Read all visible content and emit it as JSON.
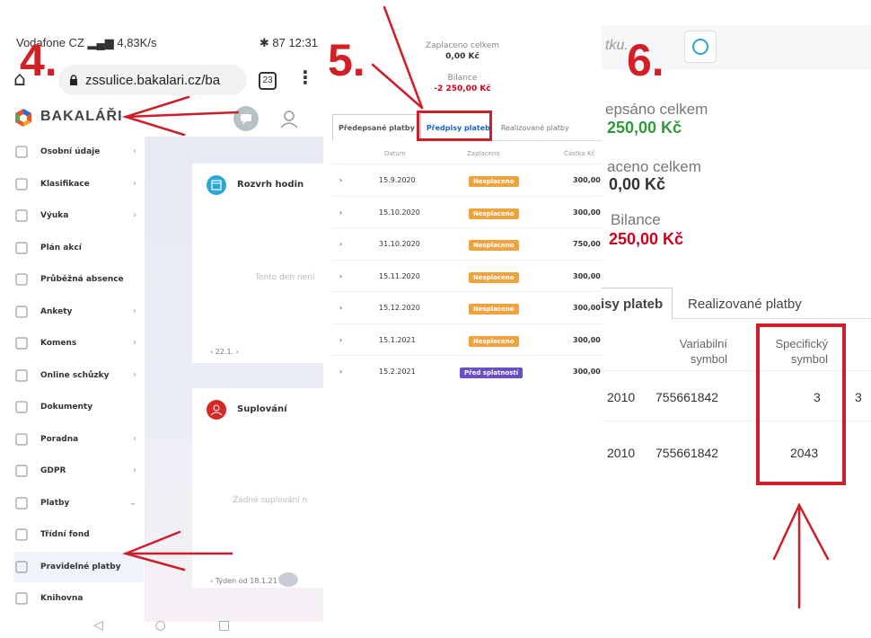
{
  "steps": {
    "s4": "4.",
    "s5": "5.",
    "s6": "6."
  },
  "phone": {
    "carrier": "Vodafone CZ",
    "speed": "4,83K/s",
    "battery": "87",
    "time": "12:31",
    "url": "zssulice.bakalari.cz/ba",
    "tab_count": "23"
  },
  "app": {
    "title": "BAKALÁŘI"
  },
  "sidebar": {
    "items": [
      {
        "label": "Osobní údaje",
        "icon": "person-icon",
        "chevron": "›"
      },
      {
        "label": "Klasifikace",
        "icon": "grade-icon",
        "chevron": "›"
      },
      {
        "label": "Výuka",
        "icon": "teaching-icon",
        "chevron": "›"
      },
      {
        "label": "Plán akcí",
        "icon": "people-icon",
        "chevron": ""
      },
      {
        "label": "Průběžná absence",
        "icon": "absence-icon",
        "chevron": ""
      },
      {
        "label": "Ankety",
        "icon": "poll-icon",
        "chevron": "›"
      },
      {
        "label": "Komens",
        "icon": "message-icon",
        "chevron": "›"
      },
      {
        "label": "Online schůzky",
        "icon": "meeting-icon",
        "chevron": "›"
      },
      {
        "label": "Dokumenty",
        "icon": "document-icon",
        "chevron": ""
      },
      {
        "label": "Poradna",
        "icon": "counseling-icon",
        "chevron": "›"
      },
      {
        "label": "GDPR",
        "icon": "gdpr-icon",
        "chevron": "›"
      },
      {
        "label": "Platby",
        "icon": "payments-icon",
        "chevron": "⌄"
      },
      {
        "label": "Třídní fond",
        "icon": "piggy-bank-icon",
        "chevron": ""
      },
      {
        "label": "Pravidelné platby",
        "icon": "recurring-payment-icon",
        "chevron": ""
      },
      {
        "label": "Knihovna",
        "icon": "library-icon",
        "chevron": ""
      }
    ]
  },
  "cards": {
    "schedule": {
      "title": "Rozvrh hodin",
      "empty": "Tento den není",
      "nav": "‹  22.1.  ›"
    },
    "substitution": {
      "title": "Suplování",
      "empty": "Žádné suplování n",
      "nav": "‹  Týden od 18.1.21"
    }
  },
  "panel5": {
    "paid_label": "Zaplaceno celkem",
    "paid_value": "0,00 Kč",
    "balance_label": "Bilance",
    "balance_value": "-2 250,00 Kč",
    "tabs": [
      "Předepsané platby",
      "Předpisy plateb",
      "Realizované platby"
    ],
    "headers": {
      "date": "Datum",
      "paid": "Zaplaceno",
      "amount": "Částka Kč"
    },
    "rows": [
      {
        "date": "15.9.2020",
        "status": "Nesplaceno",
        "amount": "300,00"
      },
      {
        "date": "15.10.2020",
        "status": "Nesplaceno",
        "amount": "300,00"
      },
      {
        "date": "31.10.2020",
        "status": "Nesplaceno",
        "amount": "750,00"
      },
      {
        "date": "15.11.2020",
        "status": "Nesplaceno",
        "amount": "300,00"
      },
      {
        "date": "15.12.2020",
        "status": "Nesplaceno",
        "amount": "300,00"
      },
      {
        "date": "15.1.2021",
        "status": "Nesplaceno",
        "amount": "300,00"
      },
      {
        "date": "15.2.2021",
        "status": "Před splatností",
        "amount": "300,00"
      }
    ]
  },
  "panel6": {
    "search_placeholder": "tku.",
    "prescribed_label": "epsáno celkem",
    "prescribed_value": "250,00 Kč",
    "paid_label": "aceno celkem",
    "paid_value": "0,00 Kč",
    "balance_label": "Bilance",
    "balance_value": "250,00 Kč",
    "tabs": [
      "isy plateb",
      "Realizované platby"
    ],
    "headers": {
      "variable": "Variabilní symbol",
      "specific": "Specifický symbol"
    },
    "rows": [
      {
        "prefix": "2010",
        "variable": "755661842",
        "specific": "3",
        "extra": "3"
      },
      {
        "prefix": "2010",
        "variable": "755661842",
        "specific": "2043",
        "extra": ""
      }
    ]
  },
  "colors": {
    "accent_red": "#cc1f2a",
    "green": "#2e9a3a",
    "red_value": "#d0021b",
    "badge_orange": "#f0a23d",
    "badge_purple": "#6a4fc9"
  }
}
